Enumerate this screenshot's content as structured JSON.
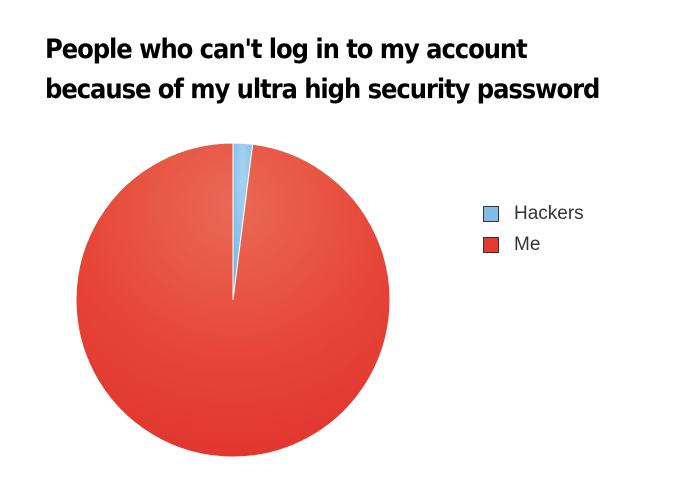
{
  "chart_data": {
    "type": "pie",
    "title_lines": [
      "People who can't log in to my account",
      "because of my ultra high security password"
    ],
    "categories": [
      "Hackers",
      "Me"
    ],
    "values": [
      2,
      98
    ],
    "colors": [
      "#7fbce8",
      "#e43a30"
    ],
    "legend_position": "right"
  }
}
